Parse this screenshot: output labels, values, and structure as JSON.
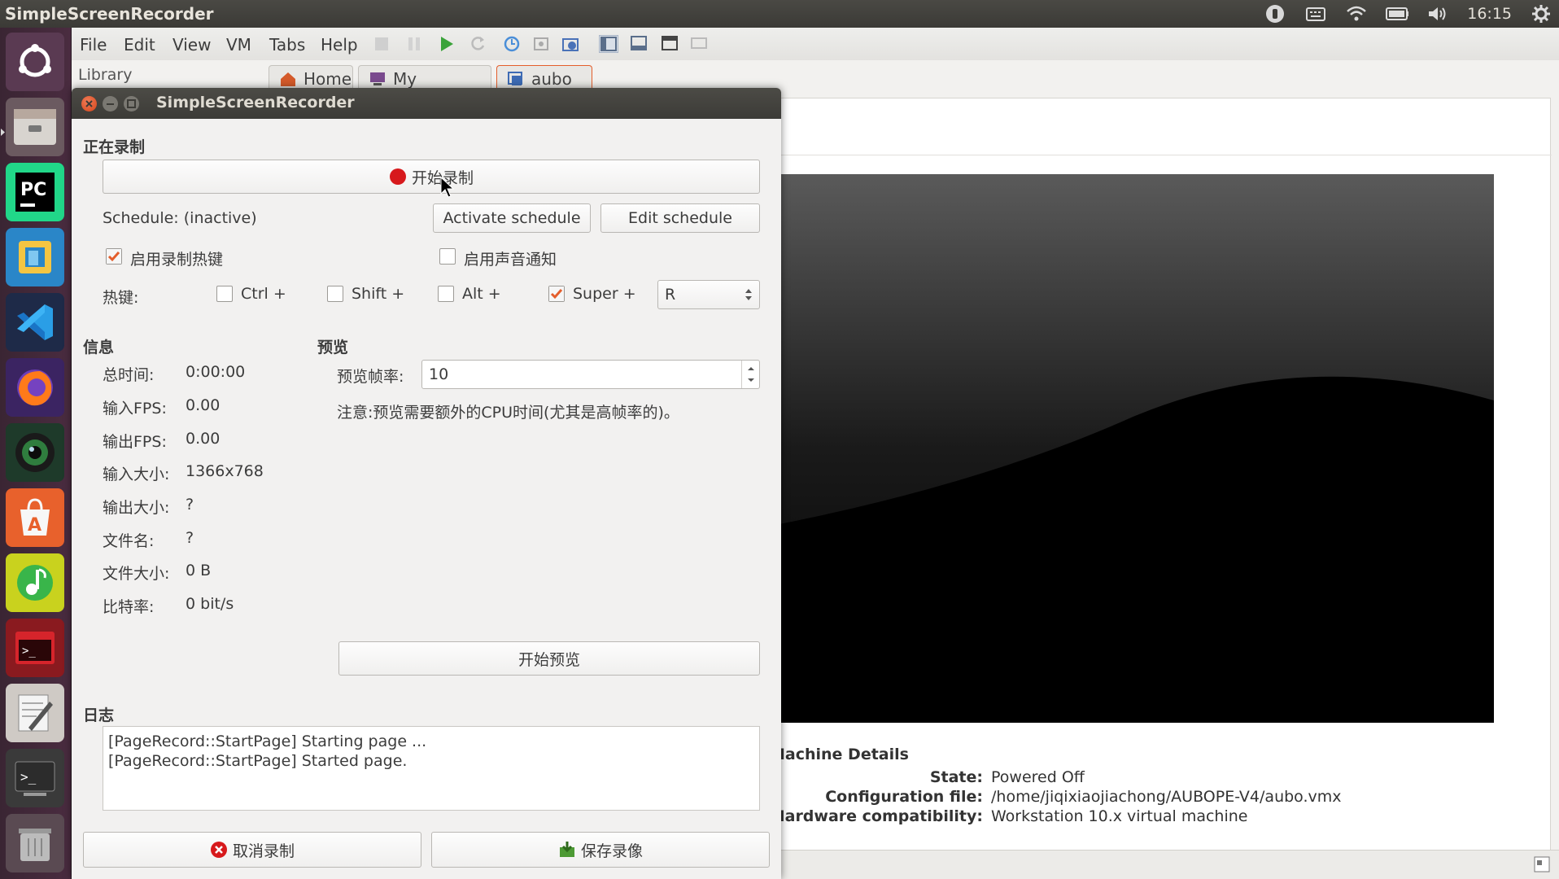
{
  "topbar": {
    "app_title": "SimpleScreenRecorder",
    "clock": "16:15",
    "tray_icons": [
      "record-indicator-icon",
      "keyboard-icon",
      "wifi-icon",
      "battery-icon",
      "volume-icon",
      "settings-gear-icon"
    ]
  },
  "launcher": {
    "items": [
      "ubuntu-dash-icon",
      "files-icon",
      "pycharm-icon",
      "virtualbox-icon",
      "vscode-icon",
      "firefox-icon",
      "camera-icon",
      "software-center-icon",
      "music-player-icon",
      "terminal-red-icon",
      "text-editor-icon",
      "terminal-icon",
      "trash-icon"
    ]
  },
  "vmware": {
    "menu": {
      "file": "File",
      "edit": "Edit",
      "view": "View",
      "vm": "VM",
      "tabs": "Tabs",
      "help": "Help"
    },
    "library_label": "Library",
    "tabs": {
      "home": "Home",
      "my_computer": "My Computer",
      "aubo": "aubo"
    },
    "details": {
      "heading": "Machine Details",
      "state_label": "State:",
      "state_value": "Powered Off",
      "config_label": "Configuration file:",
      "config_value": "/home/jiqixiaojiachong/AUBOPE-V4/aubo.vmx",
      "compat_label": "Hardware compatibility:",
      "compat_value": "Workstation 10.x virtual machine"
    }
  },
  "ssr": {
    "window_title": "SimpleScreenRecorder",
    "recording_section": "正在录制",
    "start_record_button": "开始录制",
    "schedule_status": "Schedule: (inactive)",
    "activate_schedule": "Activate schedule",
    "edit_schedule": "Edit schedule",
    "enable_hotkey": "启用录制热键",
    "enable_sound": "启用声音通知",
    "hotkey_label": "热键:",
    "ctrl": "Ctrl +",
    "shift": "Shift +",
    "alt": "Alt +",
    "super": "Super +",
    "hotkey_value": "R",
    "info_section": "信息",
    "info": {
      "total_time_label": "总时间:",
      "total_time": "0:00:00",
      "in_fps_label": "输入FPS:",
      "in_fps": "0.00",
      "out_fps_label": "输出FPS:",
      "out_fps": "0.00",
      "in_size_label": "输入大小:",
      "in_size": "1366x768",
      "out_size_label": "输出大小:",
      "out_size": "?",
      "filename_label": "文件名:",
      "filename": "?",
      "filesize_label": "文件大小:",
      "filesize": "0 B",
      "bitrate_label": "比特率:",
      "bitrate": "0 bit/s"
    },
    "preview_section": "预览",
    "preview_rate_label": "预览帧率:",
    "preview_rate_value": "10",
    "preview_note": "注意:预览需要额外的CPU时间(尤其是高帧率的)。",
    "start_preview": "开始预览",
    "log_section": "日志",
    "log_lines": [
      "[PageRecord::StartPage] Starting page ...",
      "[PageRecord::StartPage] Started page."
    ],
    "cancel_record": "取消录制",
    "save_record": "保存录像"
  },
  "colors": {
    "accent_orange": "#e45e2c",
    "record_red": "#d7191c",
    "launcher_bg": "#412a3a",
    "panel_bg": "#3c3b37"
  }
}
